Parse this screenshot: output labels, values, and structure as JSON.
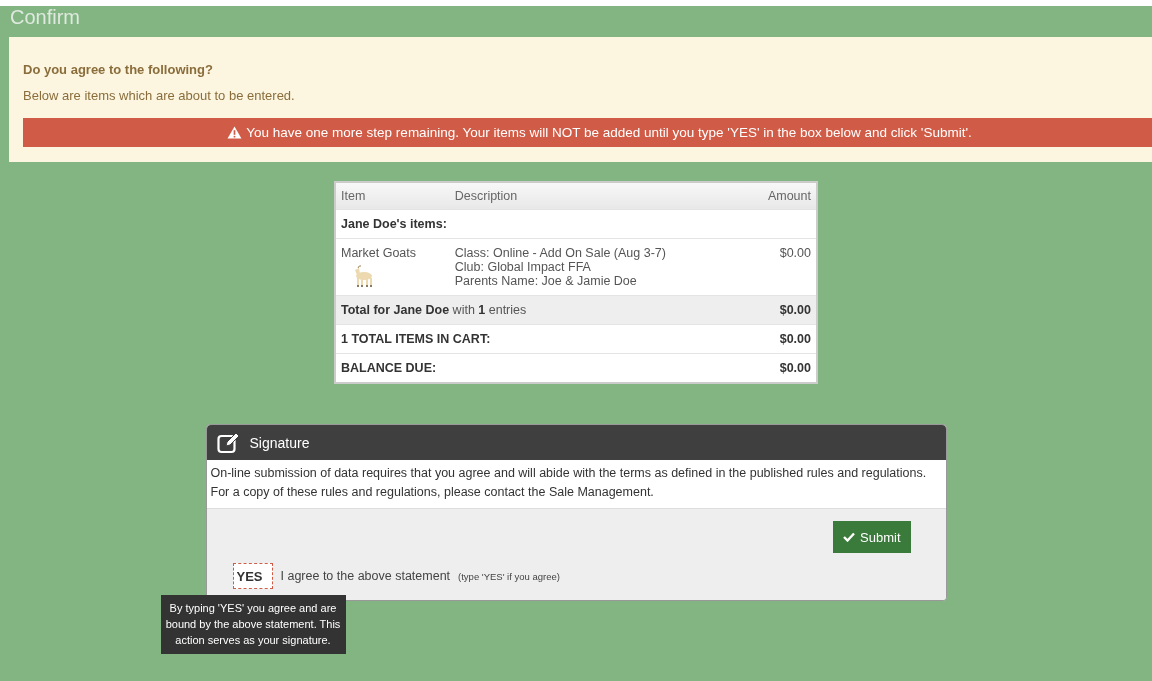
{
  "page": {
    "title": "Confirm"
  },
  "notice": {
    "heading": "Do you agree to the following?",
    "text": "Below are items which are about to be entered.",
    "warning": "You have one more step remaining. Your items will NOT be added until you type 'YES' in the box below and click 'Submit'."
  },
  "table": {
    "columns": [
      "Item",
      "Description",
      "Amount"
    ],
    "group": "Jane Doe's items:",
    "rows": [
      {
        "item": "Market Goats",
        "description": [
          "Class: Online - Add On Sale (Aug 3-7)",
          "Club: Global Impact FFA",
          "Parents Name: Joe & Jamie Doe"
        ],
        "amount": "$0.00"
      }
    ],
    "totals": [
      {
        "label": "**Total for Jane Doe** with **1** entries",
        "amount": "$0.00",
        "shaded": true
      },
      {
        "label": "1 TOTAL ITEMS IN CART:",
        "amount": "$0.00",
        "shaded": false
      },
      {
        "label": "BALANCE DUE:",
        "amount": "$0.00",
        "shaded": false
      }
    ]
  },
  "signature": {
    "title": "Signature",
    "text": "On-line submission of data requires that you agree and will abide with the terms as defined in the published rules and regulations. For a copy of these rules and regulations, please contact the Sale Management.",
    "submit": "Submit",
    "input_value": "YES",
    "agree_label": "I agree to the above statement",
    "agree_hint": "(type 'YES' if you agree)",
    "tooltip": "By typing 'YES' you agree and are bound by the above statement. This action serves as your signature."
  }
}
